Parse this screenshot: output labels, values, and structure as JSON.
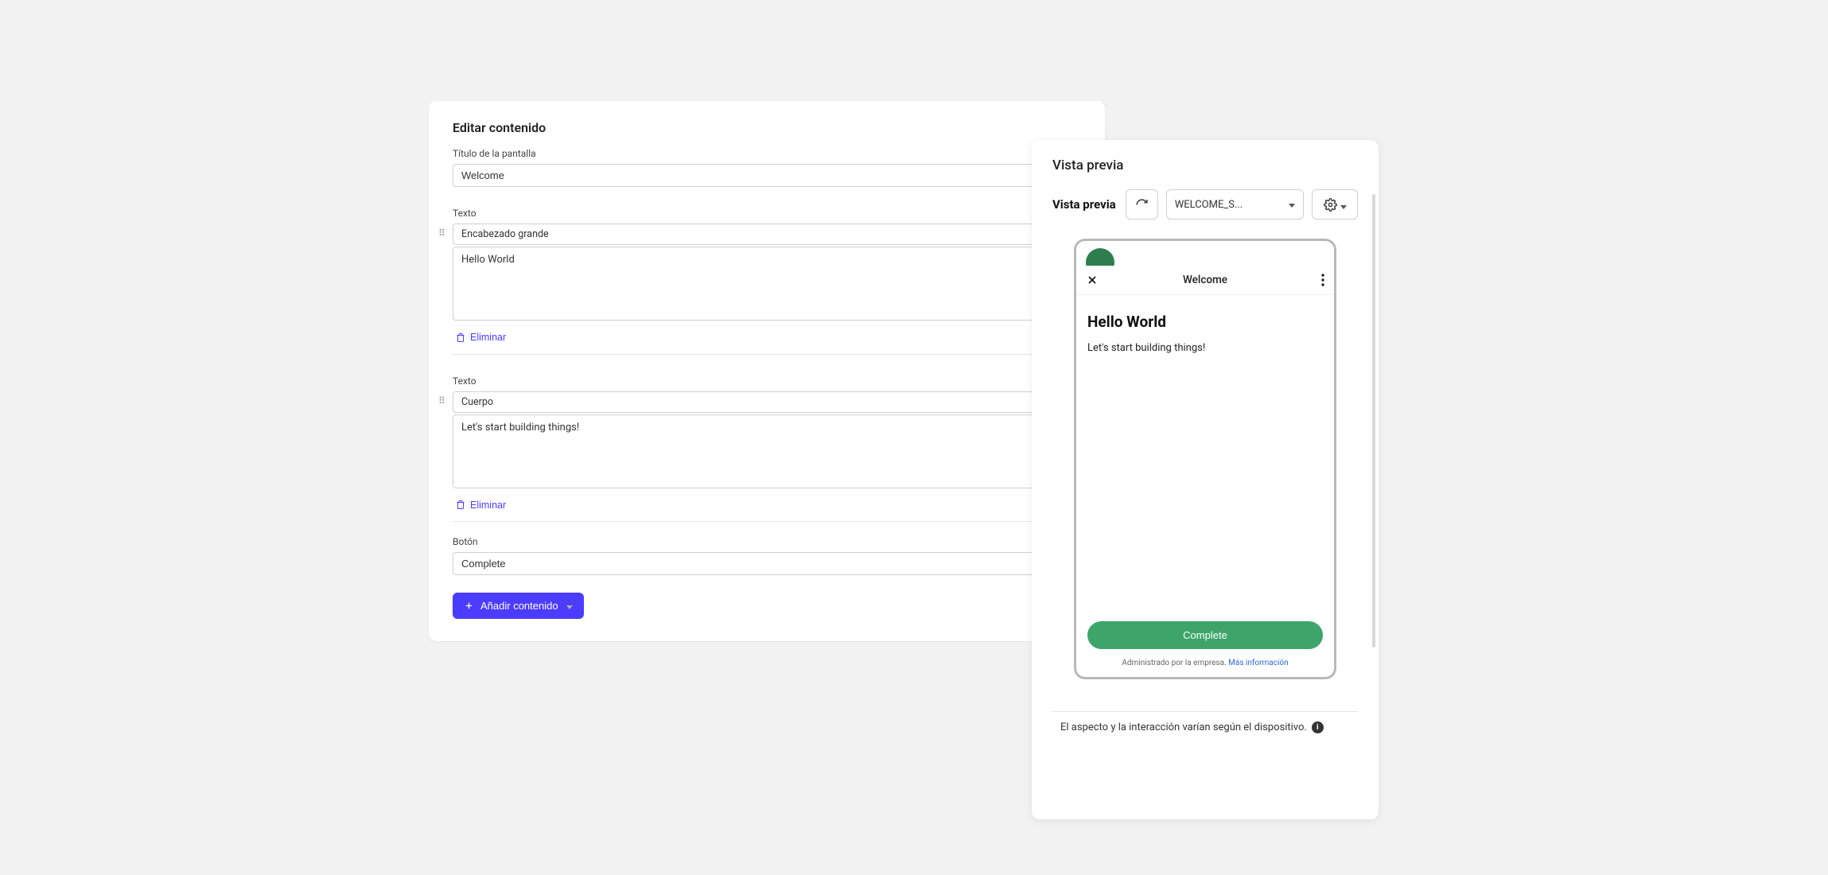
{
  "editor": {
    "title": "Editar contenido",
    "screen_title_label": "Título de la pantalla",
    "screen_title_value": "Welcome",
    "blocks": [
      {
        "type_label": "Texto",
        "variant": "Encabezado grande",
        "content": "Hello World",
        "delete_label": "Eliminar"
      },
      {
        "type_label": "Texto",
        "variant": "Cuerpo",
        "content": "Let's start building things!",
        "delete_label": "Eliminar"
      }
    ],
    "button_section": {
      "label": "Botón",
      "value": "Complete"
    },
    "add_button_label": "Añadir contenido"
  },
  "preview": {
    "panel_title": "Vista previa",
    "toolbar_title": "Vista previa",
    "screen_select_value": "WELCOME_S...",
    "phone": {
      "header_title": "Welcome",
      "heading": "Hello World",
      "body": "Let's start building things!",
      "button_label": "Complete",
      "managed_text": "Administrado por la empresa.",
      "more_info_label": "Más información"
    },
    "footer_note": "El aspecto y la interacción varían según el dispositivo."
  }
}
